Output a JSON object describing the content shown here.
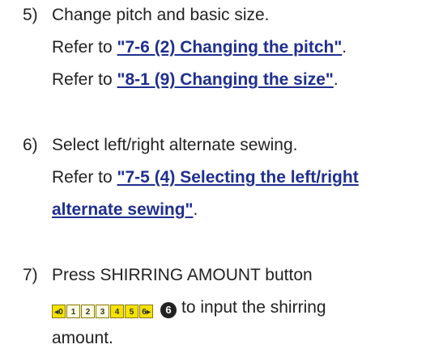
{
  "step5": {
    "number": "5)",
    "text": "Change pitch and basic size.",
    "ref1_prefix": "Refer to ",
    "ref1_link": "\"7-6 (2) Changing the pitch\"",
    "ref1_suffix": ".",
    "ref2_prefix": "Refer to ",
    "ref2_link": "\"8-1 (9) Changing the size\"",
    "ref2_suffix": "."
  },
  "step6": {
    "number": "6)",
    "text": "Select left/right alternate sewing.",
    "ref_prefix": "Refer to ",
    "ref_link_line1": "\"7-5 (4) Selecting the left/right",
    "ref_link_line2": "alternate sewing\"",
    "ref_suffix": "."
  },
  "step7": {
    "number": "7)",
    "text": "Press SHIRRING AMOUNT button",
    "shirring_cells": [
      "◂0",
      "1",
      "2",
      "3",
      "4",
      "5",
      "6▸"
    ],
    "callout": "6",
    "after_button": "to input the shirring",
    "line3": "amount."
  }
}
